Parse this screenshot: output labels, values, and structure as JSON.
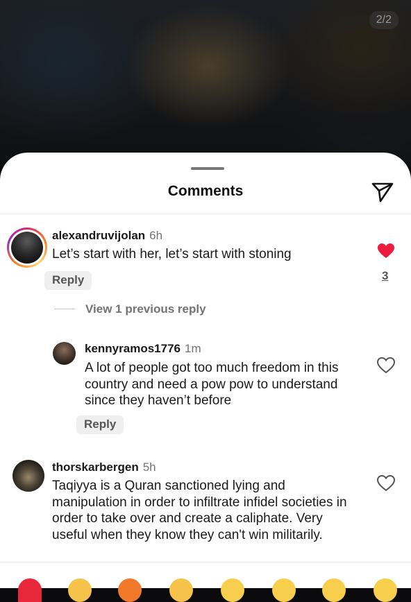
{
  "header": {
    "page_counter": "2/2"
  },
  "sheet": {
    "title": "Comments"
  },
  "comments": [
    {
      "username": "alexandruvijolan",
      "time": "6h",
      "text": "Let’s start with her, let’s start with stoning",
      "reply_label": "Reply",
      "liked": true,
      "like_count": "3"
    },
    {
      "username": "kennyramos1776",
      "time": "1m",
      "text": "A lot of people got too much freedom in this country and need a pow pow to understand since they haven’t before",
      "reply_label": "Reply",
      "liked": false
    },
    {
      "username": "thorskarbergen",
      "time": "5h",
      "text": "Taqiyya is a Quran sanctioned lying and manipulation in order to infiltrate infidel societies in order to take over and create a caliphate. Very useful when they know they can't win militarily.",
      "liked": false
    }
  ],
  "view_replies_label": "View 1 previous reply",
  "emoji_bar": [
    "red-heart",
    "raising-hands",
    "fire",
    "clapping-hands",
    "crying-laughing",
    "heart-eyes",
    "astonished",
    "smiling"
  ],
  "colors": {
    "like_red": "#ed1b3c",
    "story_ring": "#d62976"
  }
}
